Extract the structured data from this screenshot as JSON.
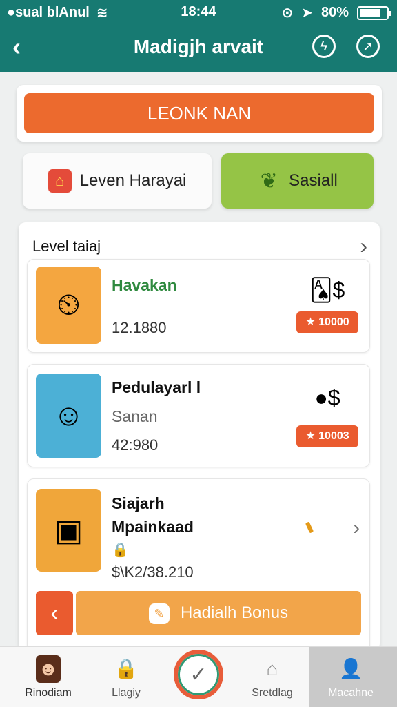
{
  "status": {
    "carrier": "●sual blAnul",
    "time": "18:44",
    "battery": "80%",
    "battery_level": 0.8
  },
  "header": {
    "back_icon": "chevron-left-icon",
    "title": "Madigjh arvait",
    "icon_a": "lightning-icon",
    "icon_b": "compass-icon"
  },
  "banner": {
    "label": "LEONK NAN"
  },
  "tabs": [
    {
      "label": "Leven Harayai",
      "icon": "house-icon"
    },
    {
      "label": "Sasiall",
      "icon": "leaf-icon"
    }
  ],
  "section": {
    "title": "Level taiaj"
  },
  "items": [
    {
      "title": "Havakan",
      "value": "12.1880",
      "reward": "★ 10000",
      "thumb_icon": "clock-icon",
      "reward_icon": "cards-coins-icon"
    },
    {
      "title": "Pedulayarl l",
      "subtitle": "Sanan",
      "value": "42:980",
      "reward": "★ 10003",
      "thumb_icon": "shop-icon",
      "reward_icon": "coins-icon"
    },
    {
      "title_line1": "Siajarh",
      "title_line2": "Mpainkaad",
      "value": "$\\K2/38.210",
      "thumb_icon": "treasure-box-icon"
    }
  ],
  "bonus": {
    "label": "Hadialh Bonus",
    "prev_icon": "chevron-left-icon"
  },
  "tabbar": {
    "items": [
      {
        "label": "Rinodiam",
        "icon": "avatar-icon"
      },
      {
        "label": "Llagiy",
        "icon": "lock-icon"
      },
      {
        "label": "Sretdlag",
        "icon": "home-icon"
      },
      {
        "label": "Macahne",
        "icon": "user-icon"
      }
    ],
    "center_icon": "check-icon"
  },
  "colors": {
    "header": "#177a72",
    "banner": "#ec6a2e",
    "tab_green": "#95c446",
    "reward": "#ea5b2f",
    "bonus": "#f2a54a"
  }
}
